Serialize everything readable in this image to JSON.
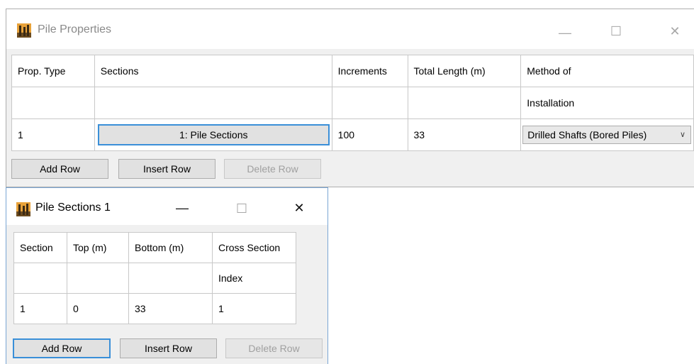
{
  "pile_properties": {
    "title": "Pile Properties",
    "controls": {
      "minimize": "—",
      "maximize": "☐",
      "close": "✕"
    },
    "headers_row1": [
      "Prop. Type",
      "Sections",
      "Increments",
      "Total Length (m)",
      "Method of"
    ],
    "headers_row2": [
      "",
      "",
      "",
      "",
      "Installation"
    ],
    "row": {
      "prop_type": "1",
      "sections_button": "1: Pile Sections",
      "increments": "100",
      "total_length": "33",
      "method": "Drilled Shafts (Bored Piles)"
    },
    "buttons": {
      "add_row": "Add Row",
      "insert_row": "Insert Row",
      "delete_row": "Delete Row"
    }
  },
  "pile_sections": {
    "title": "Pile Sections 1",
    "controls": {
      "minimize": "—",
      "maximize": "☐",
      "close": "✕"
    },
    "headers_row1": [
      "Section",
      "Top (m)",
      "Bottom (m)",
      "Cross Section"
    ],
    "headers_row2": [
      "",
      "",
      "",
      "Index"
    ],
    "row": {
      "section": "1",
      "top": "0",
      "bottom": "33",
      "cross_section_index": "1"
    },
    "buttons": {
      "add_row": "Add Row",
      "insert_row": "Insert Row",
      "delete_row": "Delete Row"
    }
  }
}
